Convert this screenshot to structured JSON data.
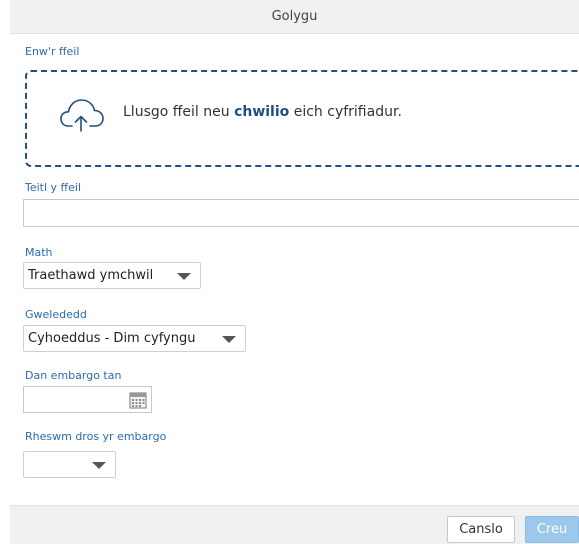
{
  "dialog": {
    "title": "Golygu"
  },
  "file_name": {
    "label": "Enw'r ffeil",
    "drop_text": "Llusgo ffeil neu ",
    "drop_link": "chwilio",
    "drop_suffix": " eich cyfrifiadur."
  },
  "file_title": {
    "label": "Teitl y ffeil",
    "value": ""
  },
  "type": {
    "label": "Math",
    "selected": "Traethawd ymchwil"
  },
  "visibility": {
    "label": "Gwelededd",
    "selected": "Cyhoeddus - Dim cyfyngu"
  },
  "embargo_until": {
    "label": "Dan embargo tan",
    "value": ""
  },
  "embargo_reason": {
    "label": "Rheswm dros yr embargo",
    "selected": ""
  },
  "footer": {
    "cancel_label": "Canslo",
    "create_label": "Creu"
  },
  "icons": {
    "upload": "cloud-upload-icon",
    "calendar": "calendar-icon"
  },
  "colors": {
    "accent": "#2a6bb0",
    "dropzone_border": "#1f4f86",
    "create_button": "#9cc8ee"
  }
}
